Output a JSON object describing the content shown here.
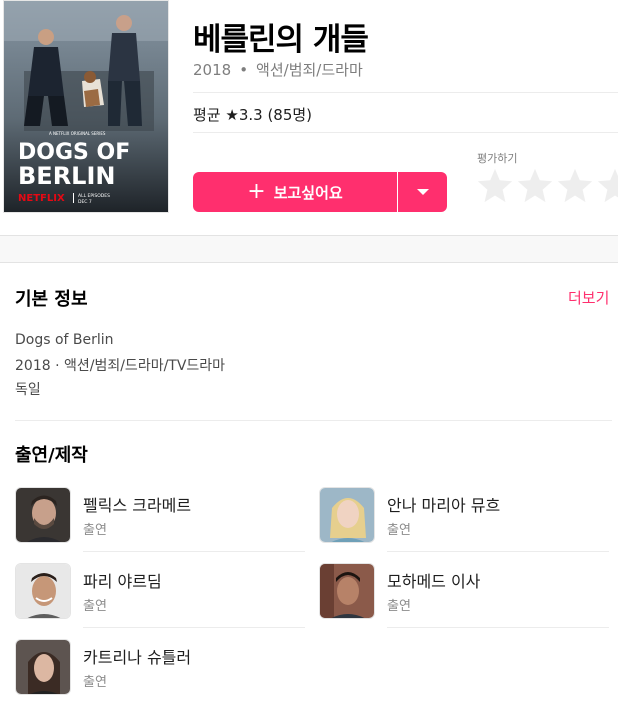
{
  "movie": {
    "title": "베를린의 개들",
    "year": "2018",
    "genre": "액션/범죄/드라마",
    "separator": "•",
    "rating_text": "평균 ★3.3 (85명)",
    "poster": {
      "title_line1": "DOGS OF",
      "title_line2": "BERLIN",
      "brand": "NETFLIX",
      "tagline": "ALL EPISODES",
      "date": "DEC 7",
      "series_label": "A NETFLIX ORIGINAL SERIES"
    }
  },
  "actions": {
    "wish_label": "보고싶어요",
    "rate_label": "평가하기",
    "rating_value": 0,
    "star_count": 4
  },
  "basic_info": {
    "title": "기본 정보",
    "more": "더보기",
    "original_title": "Dogs of Berlin",
    "details": "2018 · 액션/범죄/드라마/TV드라마",
    "country": "독일"
  },
  "cast": {
    "title": "출연/제작",
    "people": [
      {
        "name": "펠릭스 크라메르",
        "role": "출연"
      },
      {
        "name": "안나 마리아 뮤흐",
        "role": "출연"
      },
      {
        "name": "파리 야르딤",
        "role": "출연"
      },
      {
        "name": "모하메드 이사",
        "role": "출연"
      },
      {
        "name": "카트리나 슈틀러",
        "role": "출연"
      }
    ]
  },
  "colors": {
    "accent": "#ff2f6e",
    "text": "#1e1e1e",
    "muted": "#7e7e7e"
  }
}
